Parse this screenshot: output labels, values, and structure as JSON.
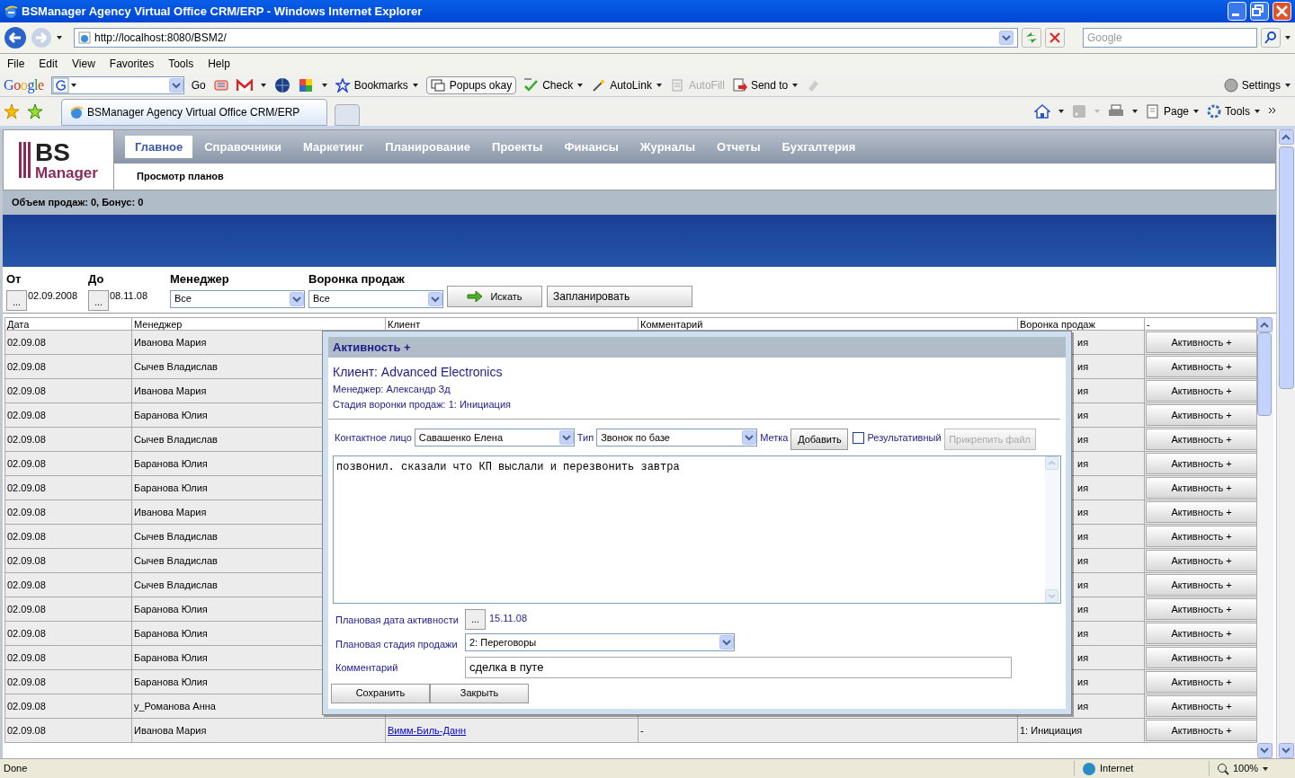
{
  "browser": {
    "title": "BSManager Agency Virtual Office CRM/ERP - Windows Internet Explorer",
    "address": "http://localhost:8080/BSM2/",
    "search_placeholder": "Google",
    "menu": [
      "File",
      "Edit",
      "View",
      "Favorites",
      "Tools",
      "Help"
    ],
    "google_toolbar": {
      "logo": "Google",
      "go": "Go",
      "items": [
        {
          "label": "Bookmarks",
          "kind": "bookmarks",
          "disabled": false
        },
        {
          "label": "Popups okay",
          "kind": "popups",
          "disabled": false
        },
        {
          "label": "Check",
          "kind": "check",
          "disabled": false
        },
        {
          "label": "AutoLink",
          "kind": "autolink",
          "disabled": false
        },
        {
          "label": "AutoFill",
          "kind": "autofill",
          "disabled": true
        },
        {
          "label": "Send to",
          "kind": "sendto",
          "disabled": false
        }
      ],
      "settings": "Settings"
    },
    "tab": {
      "title": "BSManager Agency Virtual Office CRM/ERP"
    },
    "commands": [
      "Page",
      "Tools"
    ],
    "status_bar": {
      "text": "Done",
      "zone": "Internet",
      "zoom": "100%"
    }
  },
  "app": {
    "logo": {
      "top": "BS",
      "bottom": "Manager"
    },
    "nav": [
      {
        "label": "Главное",
        "selected": true
      },
      {
        "label": "Справочники",
        "selected": false
      },
      {
        "label": "Маркетинг",
        "selected": false
      },
      {
        "label": "Планирование",
        "selected": false
      },
      {
        "label": "Проекты",
        "selected": false
      },
      {
        "label": "Финансы",
        "selected": false
      },
      {
        "label": "Журналы",
        "selected": false
      },
      {
        "label": "Отчеты",
        "selected": false
      },
      {
        "label": "Бухгалтерия",
        "selected": false
      }
    ],
    "subnav": "Просмотр планов",
    "summary": "Объем продаж: 0, Бонус: 0",
    "filters": {
      "from_label": "От",
      "from_value": "02.09.2008",
      "to_label": "До",
      "to_value": "08.11.08",
      "picker": "...",
      "manager_label": "Менеджер",
      "manager_value": "Все",
      "funnel_label": "Воронка продаж",
      "funnel_value": "Все",
      "search_button": "Искать",
      "plan_button": "Запланировать"
    },
    "table": {
      "columns": [
        "Дата",
        "Менеджер",
        "Клиент",
        "Комментарий",
        "Воронка продаж",
        "-"
      ],
      "rows": [
        {
          "date": "02.09.08",
          "manager": "Иванова Мария",
          "funnel": "ия",
          "action": "Активность +"
        },
        {
          "date": "02.09.08",
          "manager": "Сычев Владислав",
          "funnel": "ия",
          "action": "Активность +"
        },
        {
          "date": "02.09.08",
          "manager": "Иванова Мария",
          "funnel": "ия",
          "action": "Активность +"
        },
        {
          "date": "02.09.08",
          "manager": "Баранова Юлия",
          "funnel": "ия",
          "action": "Активность +"
        },
        {
          "date": "02.09.08",
          "manager": "Сычев Владислав",
          "funnel": "ия",
          "action": "Активность +"
        },
        {
          "date": "02.09.08",
          "manager": "Баранова Юлия",
          "funnel": "ия",
          "action": "Активность +"
        },
        {
          "date": "02.09.08",
          "manager": "Баранова Юлия",
          "funnel": "ия",
          "action": "Активность +"
        },
        {
          "date": "02.09.08",
          "manager": "Иванова Мария",
          "funnel": "ия",
          "action": "Активность +"
        },
        {
          "date": "02.09.08",
          "manager": "Сычев Владислав",
          "funnel": "ия",
          "action": "Активность +"
        },
        {
          "date": "02.09.08",
          "manager": "Сычев Владислав",
          "funnel": "ия",
          "action": "Активность +"
        },
        {
          "date": "02.09.08",
          "manager": "Сычев Владислав",
          "funnel": "ия",
          "action": "Активность +"
        },
        {
          "date": "02.09.08",
          "manager": "Баранова Юлия",
          "funnel": "ия",
          "action": "Активность +"
        },
        {
          "date": "02.09.08",
          "manager": "Баранова Юлия",
          "funnel": "ия",
          "action": "Активность +"
        },
        {
          "date": "02.09.08",
          "manager": "Баранова Юлия",
          "funnel": "ия",
          "action": "Активность +"
        },
        {
          "date": "02.09.08",
          "manager": "Баранова Юлия",
          "funnel": "ия",
          "action": "Активность +"
        },
        {
          "date": "02.09.08",
          "manager": "у_Романова Анна",
          "funnel": "ия",
          "action": "Активность +"
        },
        {
          "date": "02.09.08",
          "manager": "Иванова Мария",
          "client": "Вимм-Биль-Данн",
          "comment": "-",
          "funnel": "1: Инициация",
          "action": "Активность +"
        }
      ]
    },
    "dialog": {
      "title": "Активность +",
      "client": "Клиент: Advanced Electronics",
      "manager": "Менеджер: Александр Зд",
      "stage": "Стадия воронки продаж: 1: Инициация",
      "contact_label": "Контактное лицо",
      "contact_value": "Савашенко Елена",
      "type_label": "Тип",
      "type_value": "Звонок по базе",
      "tag_label": "Метка",
      "add_button": "Добавить",
      "effective": {
        "label": "Результативный",
        "checked": false
      },
      "attach_button": {
        "label": "Прикрепить файл",
        "disabled": true
      },
      "text": "позвонил. сказали что КП выслали и перезвонить завтра",
      "date_label": "Плановая дата активности",
      "date_picker": "...",
      "date_value": "15.11.08",
      "stage_label": "Плановая стадия продажи",
      "stage_value": "2: Переговоры",
      "comment_label": "Комментарий",
      "comment_value": "сделка в путе",
      "save_button": "Сохранить",
      "close_button": "Закрыть"
    }
  }
}
